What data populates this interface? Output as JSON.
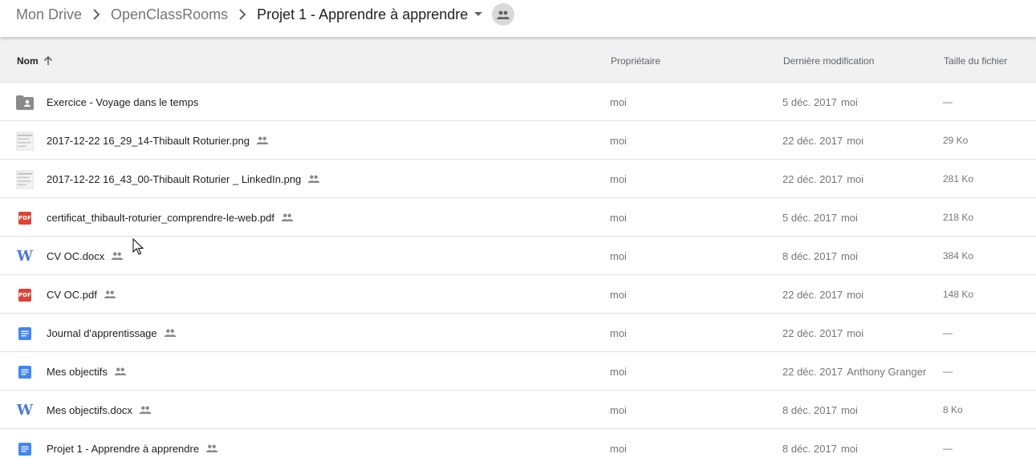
{
  "breadcrumb": {
    "items": [
      "Mon Drive",
      "OpenClassRooms"
    ],
    "current": "Projet 1 - Apprendre à apprendre"
  },
  "table": {
    "columns": {
      "name": "Nom",
      "owner": "Propriétaire",
      "modified": "Dernière modification",
      "size": "Taille du fichier"
    },
    "rows": [
      {
        "icon": "shared-folder-icon",
        "name": "Exercice - Voyage dans le temps",
        "shared": false,
        "owner": "moi",
        "date": "5 déc. 2017",
        "by": "moi",
        "size": "—"
      },
      {
        "icon": "image-thumbnail-icon",
        "name": "2017-12-22 16_29_14-Thibault Roturier.png",
        "shared": true,
        "owner": "moi",
        "date": "22 déc. 2017",
        "by": "moi",
        "size": "29 Ko"
      },
      {
        "icon": "image-thumbnail-icon",
        "name": "2017-12-22 16_43_00-Thibault Roturier _ LinkedIn.png",
        "shared": true,
        "owner": "moi",
        "date": "22 déc. 2017",
        "by": "moi",
        "size": "281 Ko"
      },
      {
        "icon": "pdf-icon",
        "name": "certificat_thibault-roturier_comprendre-le-web.pdf",
        "shared": true,
        "owner": "moi",
        "date": "5 déc. 2017",
        "by": "moi",
        "size": "218 Ko"
      },
      {
        "icon": "word-icon",
        "name": "CV OC.docx",
        "shared": true,
        "owner": "moi",
        "date": "8 déc. 2017",
        "by": "moi",
        "size": "384 Ko"
      },
      {
        "icon": "pdf-icon",
        "name": "CV OC.pdf",
        "shared": true,
        "owner": "moi",
        "date": "22 déc. 2017",
        "by": "moi",
        "size": "148 Ko"
      },
      {
        "icon": "google-docs-icon",
        "name": "Journal d'apprentissage",
        "shared": true,
        "owner": "moi",
        "date": "22 déc. 2017",
        "by": "moi",
        "size": "—"
      },
      {
        "icon": "google-docs-icon",
        "name": "Mes objectifs",
        "shared": true,
        "owner": "moi",
        "date": "22 déc. 2017",
        "by": "Anthony Granger",
        "size": "—"
      },
      {
        "icon": "word-icon",
        "name": "Mes objectifs.docx",
        "shared": true,
        "owner": "moi",
        "date": "8 déc. 2017",
        "by": "moi",
        "size": "8 Ko"
      },
      {
        "icon": "google-docs-icon",
        "name": "Projet 1 - Apprendre à apprendre",
        "shared": true,
        "owner": "moi",
        "date": "8 déc. 2017",
        "by": "moi",
        "size": "—"
      }
    ]
  },
  "colors": {
    "header_bg": "#f1f1f1",
    "pdf_red": "#db4437",
    "docs_blue": "#4285f4",
    "word_blue": "#4a7cd6",
    "muted_text": "#757575"
  }
}
